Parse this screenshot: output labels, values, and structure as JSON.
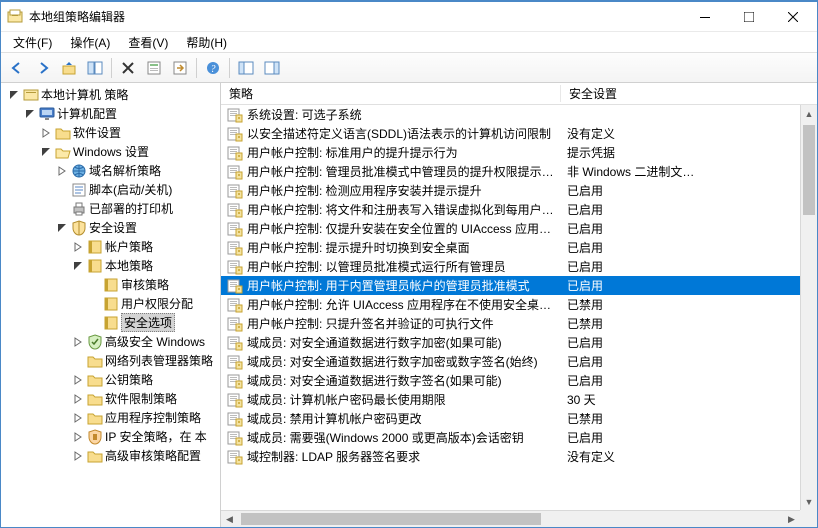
{
  "title": "本地组策略编辑器",
  "menu": {
    "file": "文件(F)",
    "action": "操作(A)",
    "view": "查看(V)",
    "help": "帮助(H)"
  },
  "list_header": {
    "policy": "策略",
    "setting": "安全设置"
  },
  "tree": {
    "root": "本地计算机 策略",
    "computer_cfg": "计算机配置",
    "software": "软件设置",
    "windows": "Windows 设置",
    "dns": "域名解析策略",
    "scripts": "脚本(启动/关机)",
    "printers": "已部署的打印机",
    "security": "安全设置",
    "account": "帐户策略",
    "local": "本地策略",
    "audit": "审核策略",
    "userright": "用户权限分配",
    "secopt": "安全选项",
    "advwin": "高级安全 Windows",
    "netlist": "网络列表管理器策略",
    "pubkey": "公钥策略",
    "swrestrict": "软件限制策略",
    "appctrl": "应用程序控制策略",
    "ipsec": "IP 安全策略，在 本",
    "advaudit": "高级审核策略配置"
  },
  "policies": [
    {
      "name": "系统设置: 可选子系统",
      "setting": ""
    },
    {
      "name": "以安全描述符定义语言(SDDL)语法表示的计算机访问限制",
      "setting": "没有定义"
    },
    {
      "name": "用户帐户控制: 标准用户的提升提示行为",
      "setting": "提示凭据"
    },
    {
      "name": "用户帐户控制: 管理员批准模式中管理员的提升权限提示的…",
      "setting": "非 Windows 二进制文…"
    },
    {
      "name": "用户帐户控制: 检测应用程序安装并提示提升",
      "setting": "已启用"
    },
    {
      "name": "用户帐户控制: 将文件和注册表写入错误虚拟化到每用户位置",
      "setting": "已启用"
    },
    {
      "name": "用户帐户控制: 仅提升安装在安全位置的 UIAccess 应用程序",
      "setting": "已启用"
    },
    {
      "name": "用户帐户控制: 提示提升时切换到安全桌面",
      "setting": "已启用"
    },
    {
      "name": "用户帐户控制: 以管理员批准模式运行所有管理员",
      "setting": "已启用"
    },
    {
      "name": "用户帐户控制: 用于内置管理员帐户的管理员批准模式",
      "setting": "已启用",
      "selected": true
    },
    {
      "name": "用户帐户控制: 允许 UIAccess 应用程序在不使用安全桌面…",
      "setting": "已禁用"
    },
    {
      "name": "用户帐户控制: 只提升签名并验证的可执行文件",
      "setting": "已禁用"
    },
    {
      "name": "域成员: 对安全通道数据进行数字加密(如果可能)",
      "setting": "已启用"
    },
    {
      "name": "域成员: 对安全通道数据进行数字加密或数字签名(始终)",
      "setting": "已启用"
    },
    {
      "name": "域成员: 对安全通道数据进行数字签名(如果可能)",
      "setting": "已启用"
    },
    {
      "name": "域成员: 计算机帐户密码最长使用期限",
      "setting": "30 天"
    },
    {
      "name": "域成员: 禁用计算机帐户密码更改",
      "setting": "已禁用"
    },
    {
      "name": "域成员: 需要强(Windows 2000 或更高版本)会话密钥",
      "setting": "已启用"
    },
    {
      "name": "域控制器: LDAP 服务器签名要求",
      "setting": "没有定义"
    }
  ]
}
